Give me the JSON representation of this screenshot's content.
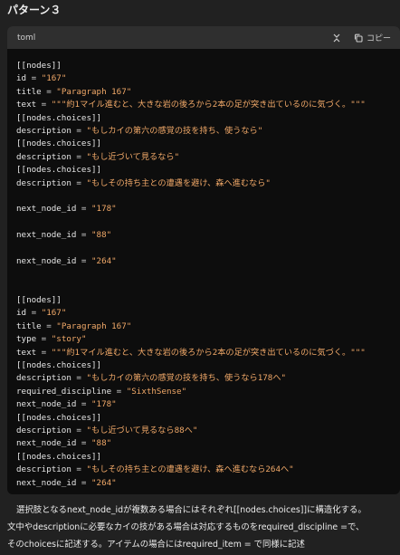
{
  "heading": "パターン３",
  "code_block": {
    "language": "toml",
    "collapse_icon": "chevrons-collapse-icon",
    "copy_icon": "copy-icon",
    "copy_label": "コピー",
    "lines": [
      [
        {
          "t": "table",
          "v": "[[nodes]]"
        }
      ],
      [
        {
          "t": "key",
          "v": "id"
        },
        {
          "t": "op",
          "v": " = "
        },
        {
          "t": "str",
          "v": "\"167\""
        }
      ],
      [
        {
          "t": "key",
          "v": "title"
        },
        {
          "t": "op",
          "v": " = "
        },
        {
          "t": "str",
          "v": "\"Paragraph 167\""
        }
      ],
      [
        {
          "t": "key",
          "v": "text"
        },
        {
          "t": "op",
          "v": " = "
        },
        {
          "t": "str",
          "v": "\"\"\"約1マイル進むと、大きな岩の後ろから2本の足が突き出ているのに気づく。\"\"\""
        }
      ],
      [
        {
          "t": "table",
          "v": "[[nodes.choices]]"
        }
      ],
      [
        {
          "t": "key",
          "v": "description"
        },
        {
          "t": "op",
          "v": " = "
        },
        {
          "t": "str",
          "v": "\"もしカイの第六の感覚の技を持ち、使うなら\""
        }
      ],
      [
        {
          "t": "table",
          "v": "[[nodes.choices]]"
        }
      ],
      [
        {
          "t": "key",
          "v": "description"
        },
        {
          "t": "op",
          "v": " = "
        },
        {
          "t": "str",
          "v": "\"もし近づいて見るなら\""
        }
      ],
      [
        {
          "t": "table",
          "v": "[[nodes.choices]]"
        }
      ],
      [
        {
          "t": "key",
          "v": "description"
        },
        {
          "t": "op",
          "v": " = "
        },
        {
          "t": "str",
          "v": "\"もしその持ち主との遭遇を避け、森へ進むなら\""
        }
      ],
      [],
      [
        {
          "t": "key",
          "v": "next_node_id"
        },
        {
          "t": "op",
          "v": " = "
        },
        {
          "t": "str",
          "v": "\"178\""
        }
      ],
      [],
      [
        {
          "t": "key",
          "v": "next_node_id"
        },
        {
          "t": "op",
          "v": " = "
        },
        {
          "t": "str",
          "v": "\"88\""
        }
      ],
      [],
      [
        {
          "t": "key",
          "v": "next_node_id"
        },
        {
          "t": "op",
          "v": " = "
        },
        {
          "t": "str",
          "v": "\"264\""
        }
      ],
      [],
      [],
      [
        {
          "t": "table",
          "v": "[[nodes]]"
        }
      ],
      [
        {
          "t": "key",
          "v": "id"
        },
        {
          "t": "op",
          "v": " = "
        },
        {
          "t": "str",
          "v": "\"167\""
        }
      ],
      [
        {
          "t": "key",
          "v": "title"
        },
        {
          "t": "op",
          "v": " = "
        },
        {
          "t": "str",
          "v": "\"Paragraph 167\""
        }
      ],
      [
        {
          "t": "key",
          "v": "type"
        },
        {
          "t": "op",
          "v": " = "
        },
        {
          "t": "str",
          "v": "\"story\""
        }
      ],
      [
        {
          "t": "key",
          "v": "text"
        },
        {
          "t": "op",
          "v": " = "
        },
        {
          "t": "str",
          "v": "\"\"\"約1マイル進むと、大きな岩の後ろから2本の足が突き出ているのに気づく。\"\"\""
        }
      ],
      [
        {
          "t": "table",
          "v": "[[nodes.choices]]"
        }
      ],
      [
        {
          "t": "key",
          "v": "description"
        },
        {
          "t": "op",
          "v": " = "
        },
        {
          "t": "str",
          "v": "\"もしカイの第六の感覚の技を持ち、使うなら178へ\""
        }
      ],
      [
        {
          "t": "key",
          "v": "required_discipline"
        },
        {
          "t": "op",
          "v": " = "
        },
        {
          "t": "str",
          "v": "\"SixthSense\""
        }
      ],
      [
        {
          "t": "key",
          "v": "next_node_id"
        },
        {
          "t": "op",
          "v": " = "
        },
        {
          "t": "str",
          "v": "\"178\""
        }
      ],
      [
        {
          "t": "table",
          "v": "[[nodes.choices]]"
        }
      ],
      [
        {
          "t": "key",
          "v": "description"
        },
        {
          "t": "op",
          "v": " = "
        },
        {
          "t": "str",
          "v": "\"もし近づいて見るなら88へ\""
        }
      ],
      [
        {
          "t": "key",
          "v": "next_node_id"
        },
        {
          "t": "op",
          "v": " = "
        },
        {
          "t": "str",
          "v": "\"88\""
        }
      ],
      [
        {
          "t": "table",
          "v": "[[nodes.choices]]"
        }
      ],
      [
        {
          "t": "key",
          "v": "description"
        },
        {
          "t": "op",
          "v": " = "
        },
        {
          "t": "str",
          "v": "\"もしその持ち主との遭遇を避け、森へ進むなら264へ\""
        }
      ],
      [
        {
          "t": "key",
          "v": "next_node_id"
        },
        {
          "t": "op",
          "v": " = "
        },
        {
          "t": "str",
          "v": "\"264\""
        }
      ]
    ]
  },
  "reply": {
    "line1": "選択肢となるnext_node_idが複数ある場合にはそれぞれ[[nodes.choices]]に構造化する。",
    "line2": "文中やdescriptionに必要なカイの技がある場合は対応するものをrequired_discipline =で、",
    "line3": "そのchoicesに記述する。アイテムの場合にはrequired_item = で同様に記述"
  }
}
